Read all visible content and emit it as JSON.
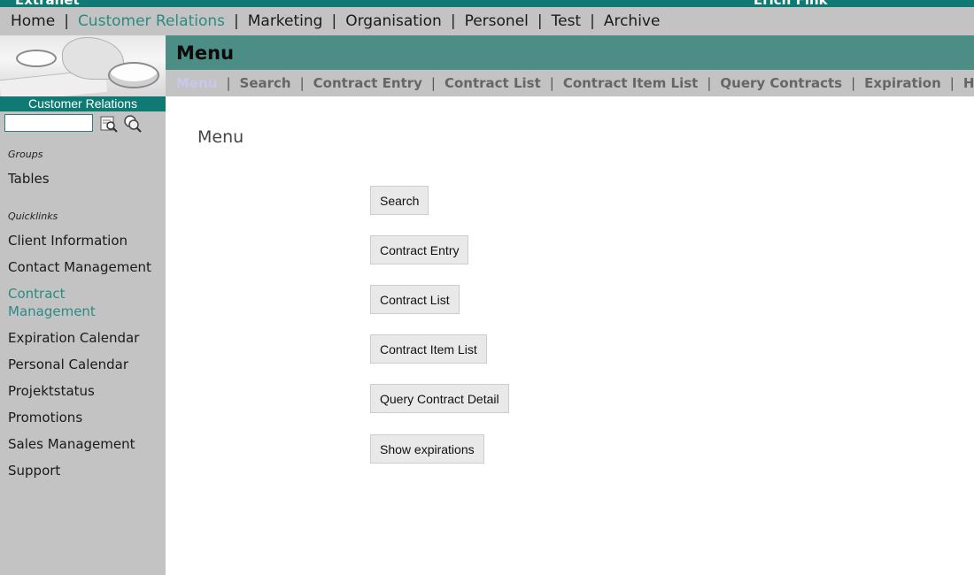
{
  "topbar": {
    "brand": "Extranet",
    "user": "Erich Fink"
  },
  "main_nav": {
    "items": [
      "Home",
      "Customer Relations",
      "Marketing",
      "Organisation",
      "Personel",
      "Test",
      "Archive"
    ],
    "active": "Customer Relations"
  },
  "sidebar": {
    "section_title": "Customer Relations",
    "search_value": "",
    "groups_label": "Groups",
    "groups": [
      "Tables"
    ],
    "quicklinks_label": "Quicklinks",
    "quicklinks": [
      "Client Information",
      "Contact Management",
      "Contract Management",
      "Expiration Calendar",
      "Personal Calendar",
      "Projektstatus",
      "Promotions",
      "Sales Management",
      "Support"
    ],
    "active_quicklink": "Contract Management",
    "icons": [
      "simple-search-icon",
      "advanced-search-icon"
    ]
  },
  "page": {
    "header_title": "Menu",
    "sub_nav": [
      "Menu",
      "Search",
      "Contract Entry",
      "Contract List",
      "Contract Item List",
      "Query Contracts",
      "Expiration",
      "Help"
    ],
    "active_sub": "Menu",
    "content_title": "Menu",
    "buttons": [
      "Search",
      "Contract Entry",
      "Contract List",
      "Contract Item List",
      "Query Contract Detail",
      "Show expirations"
    ]
  },
  "colors": {
    "teal": "#0f7a73",
    "header_teal": "#4c8d86",
    "nav_gray": "#c3c3c3",
    "active_link": "#2b8b83"
  }
}
